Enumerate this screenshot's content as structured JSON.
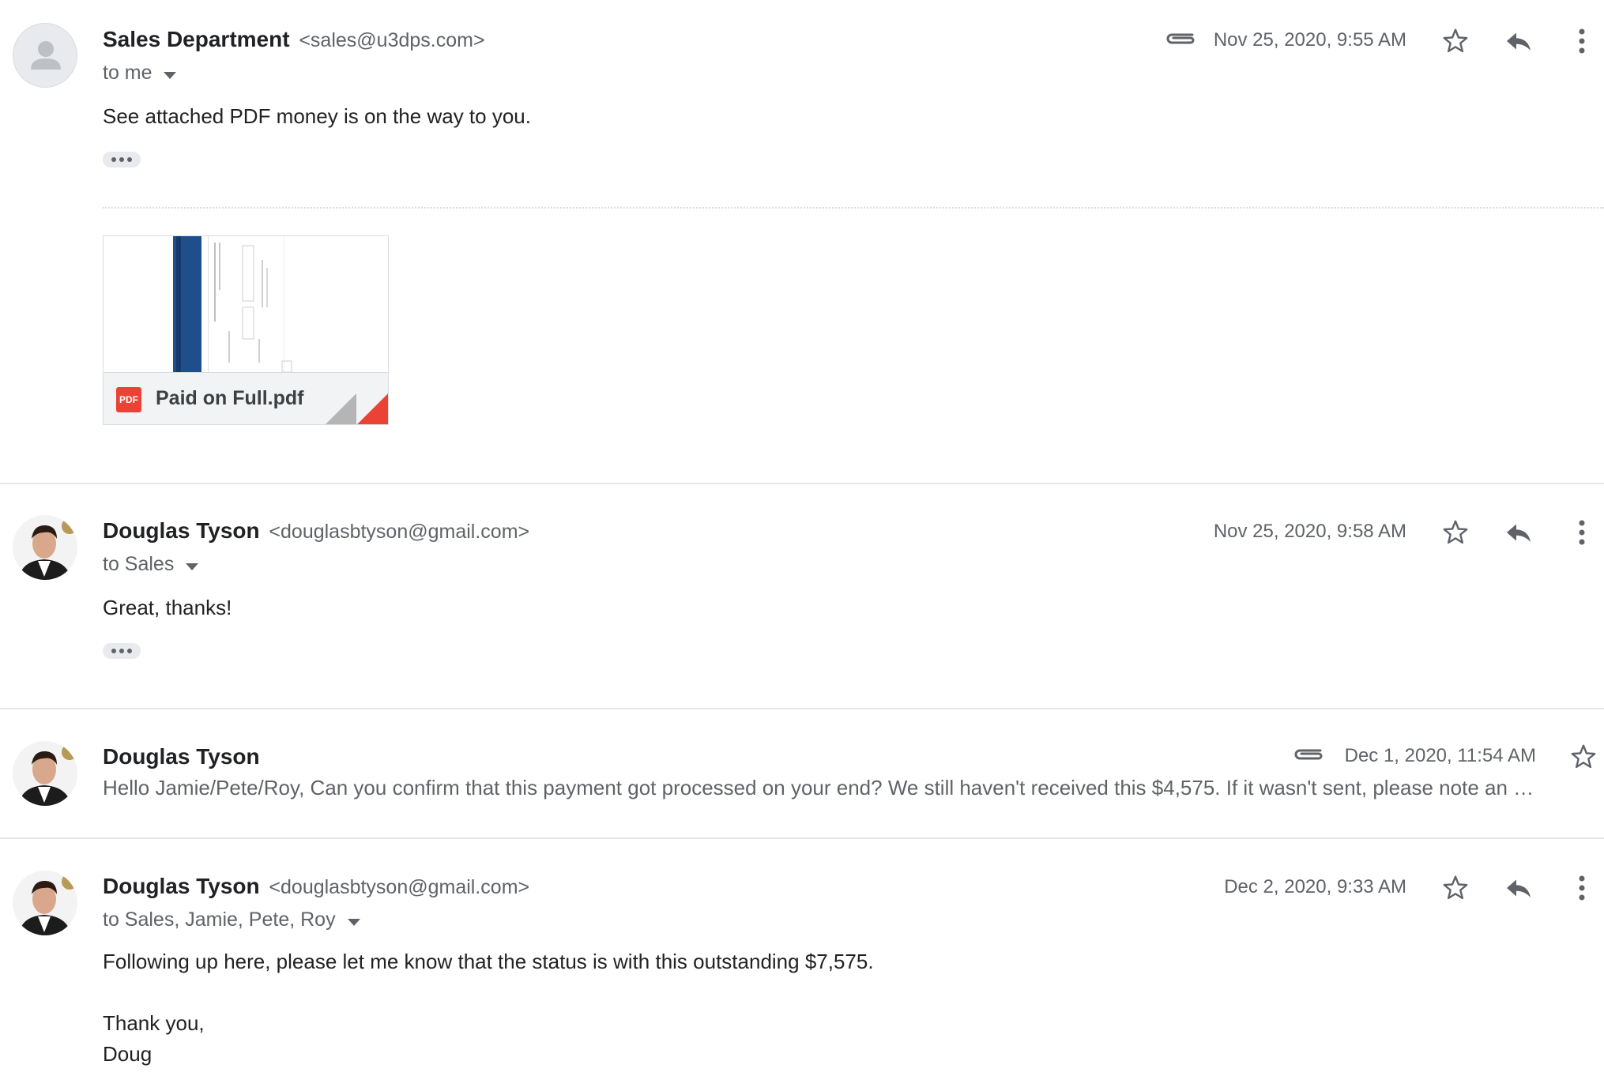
{
  "colors": {
    "accent_red": "#ea4335",
    "icon_gray": "#5f6368",
    "divider": "#e6e6e6"
  },
  "messages": [
    {
      "sender_name": "Sales Department",
      "sender_email": "<sales@u3dps.com>",
      "to_text": "to me",
      "date": "Nov 25, 2020, 9:55 AM",
      "has_attachment": true,
      "body": "See attached PDF money is on the way to you.",
      "avatar_icon": "person-icon",
      "attachment": {
        "file_name": "Paid on Full.pdf",
        "badge": "PDF"
      }
    },
    {
      "sender_name": "Douglas Tyson",
      "sender_email": "<douglasbtyson@gmail.com>",
      "to_text": "to Sales",
      "date": "Nov 25, 2020, 9:58 AM",
      "has_attachment": false,
      "body": "Great, thanks!"
    },
    {
      "sender_name": "Douglas Tyson",
      "date": "Dec 1, 2020, 11:54 AM",
      "has_attachment": true,
      "collapsed": true,
      "snippet": "Hello Jamie/Pete/Roy, Can you confirm that this payment got processed on your end? We still haven't received this $4,575. If it wasn't sent, please note an …"
    },
    {
      "sender_name": "Douglas Tyson",
      "sender_email": "<douglasbtyson@gmail.com>",
      "to_text": "to Sales, Jamie, Pete, Roy",
      "date": "Dec 2, 2020, 9:33 AM",
      "has_attachment": false,
      "body_lines": [
        "Following up here, please let me know that the status is with this outstanding $7,575.",
        "Thank you,",
        "Doug"
      ]
    }
  ],
  "icons": {
    "star": "star-icon",
    "reply": "reply-icon",
    "more": "more-vert-icon",
    "attachment": "paperclip-icon",
    "expand": "ellipsis-icon",
    "caret": "chevron-down-icon"
  }
}
